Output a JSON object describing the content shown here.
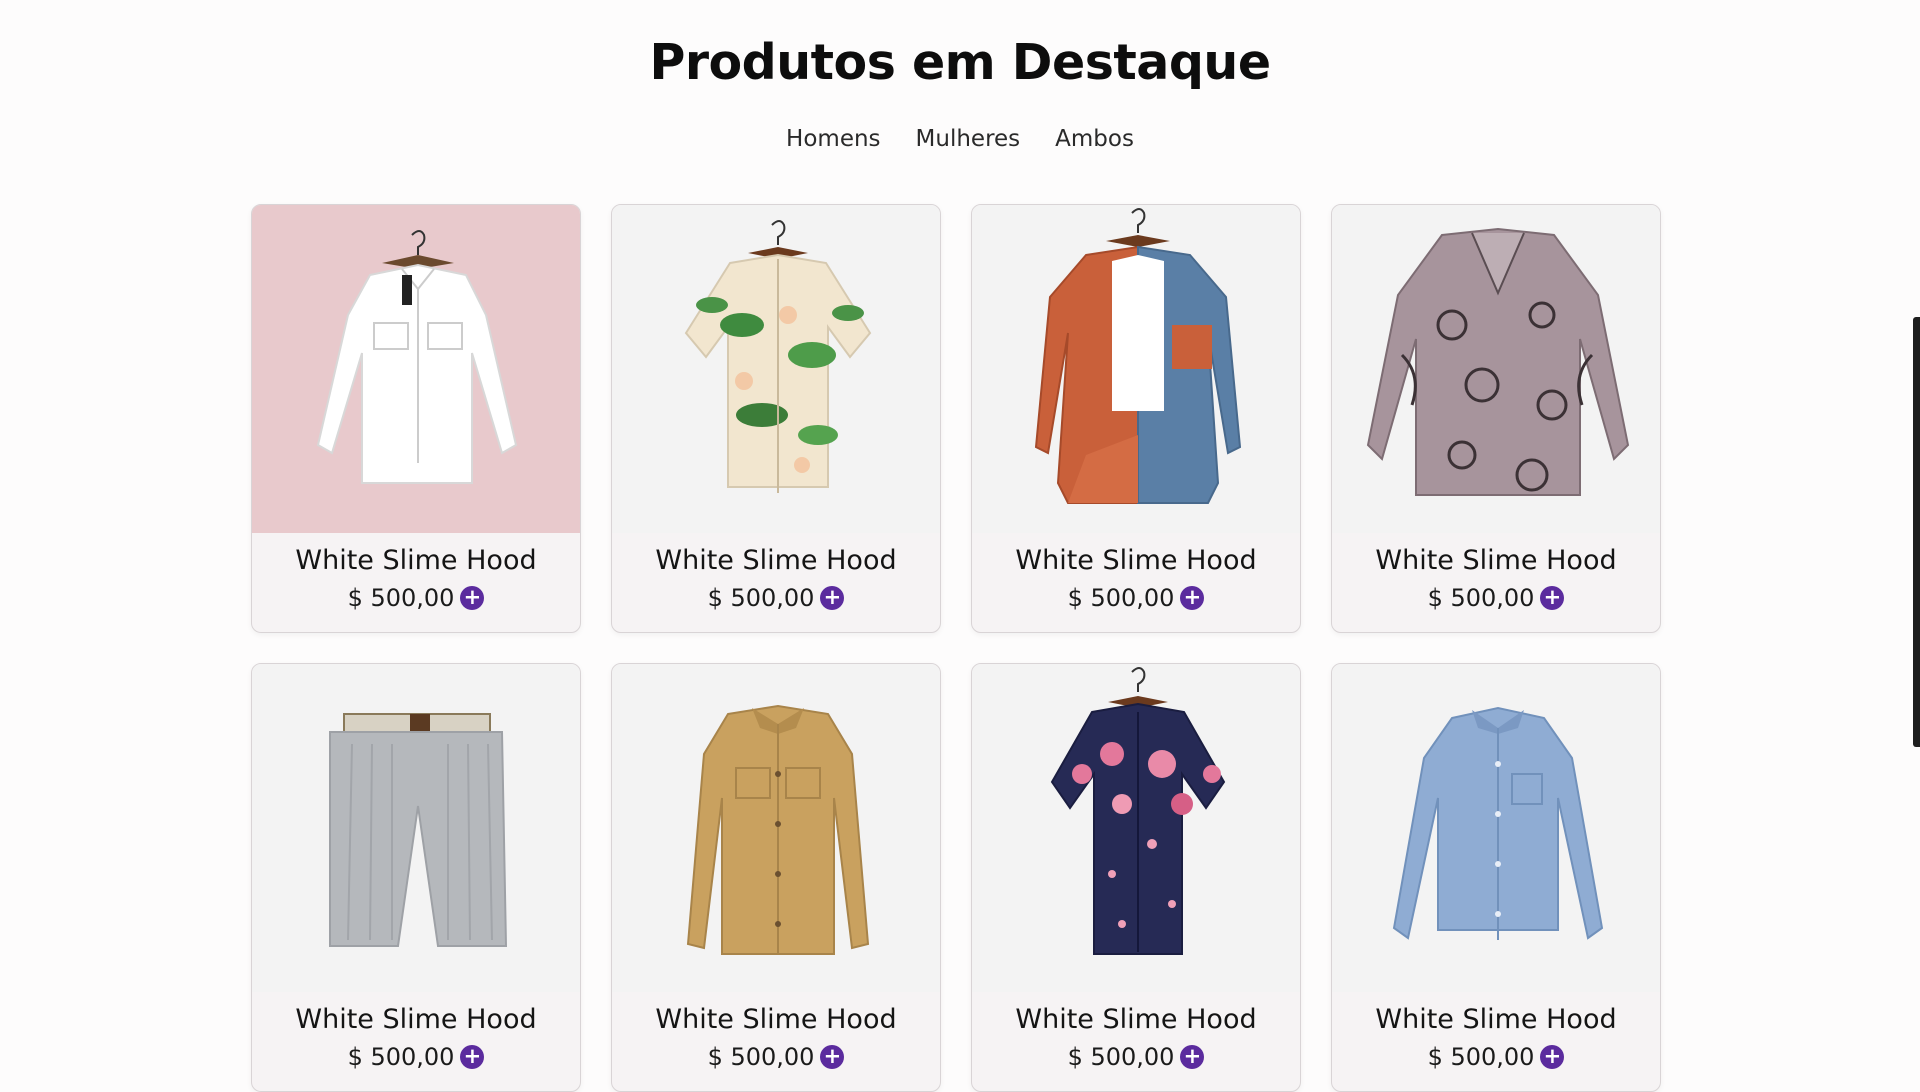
{
  "section": {
    "title": "Produtos em Destaque",
    "filters": [
      "Homens",
      "Mulheres",
      "Ambos"
    ]
  },
  "colors": {
    "accent": "#5b2b9e",
    "card_bg": "#f6f3f4"
  },
  "products": [
    {
      "name": "White Slime Hood",
      "price": "$ 500,00",
      "add_icon": "+",
      "image": "white-denim-jacket"
    },
    {
      "name": "White Slime Hood",
      "price": "$ 500,00",
      "add_icon": "+",
      "image": "floral-leaf-shirt"
    },
    {
      "name": "White Slime Hood",
      "price": "$ 500,00",
      "add_icon": "+",
      "image": "orange-blue-corduroy-shirt"
    },
    {
      "name": "White Slime Hood",
      "price": "$ 500,00",
      "add_icon": "+",
      "image": "mauve-cat-print-blouse"
    },
    {
      "name": "White Slime Hood",
      "price": "$ 500,00",
      "add_icon": "+",
      "image": "grey-striped-shorts"
    },
    {
      "name": "White Slime Hood",
      "price": "$ 500,00",
      "add_icon": "+",
      "image": "khaki-overshirt"
    },
    {
      "name": "White Slime Hood",
      "price": "$ 500,00",
      "add_icon": "+",
      "image": "navy-floral-shirt"
    },
    {
      "name": "White Slime Hood",
      "price": "$ 500,00",
      "add_icon": "+",
      "image": "light-blue-denim-shirt"
    }
  ]
}
